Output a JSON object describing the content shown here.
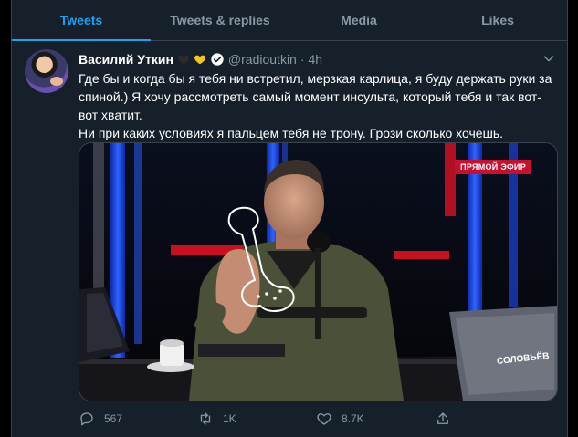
{
  "tabs": [
    {
      "label": "Tweets",
      "active": true
    },
    {
      "label": "Tweets & replies",
      "active": false
    },
    {
      "label": "Media",
      "active": false
    },
    {
      "label": "Likes",
      "active": false
    }
  ],
  "tweet": {
    "display_name": "Василий Уткин",
    "handle": "@radioutkin",
    "separator": "·",
    "time": "4h",
    "text_lines": [
      "Где бы и когда бы я тебя ни встретил, мерзкая карлица, я буду держать руки за спиной.) Я хочу рассмотреть самый момент инсульта, который тебя и так вот-вот хватит.",
      "Ни при каких условиях я пальцем тебя не трону. Грози сколько хочешь."
    ],
    "media": {
      "badge": "ПРЯМОЙ ЭФИР",
      "brand_text": "СОЛОВЬЁВ"
    },
    "actions": {
      "reply_count": "567",
      "retweet_count": "1K",
      "like_count": "8.7K"
    }
  },
  "colors": {
    "background": "#15202b",
    "accent": "#1da1f2",
    "muted": "#8899a6",
    "border": "#38444d",
    "heart_black": "#2b2b2b",
    "heart_yellow": "#f5c518",
    "live_red": "#c8102e"
  },
  "icons": {
    "hearts": [
      "black-heart-icon",
      "yellow-heart-icon"
    ],
    "verified": "verified-badge-icon",
    "menu": "chevron-down-icon",
    "actions": [
      "reply-icon",
      "retweet-icon",
      "like-icon",
      "share-icon"
    ]
  }
}
